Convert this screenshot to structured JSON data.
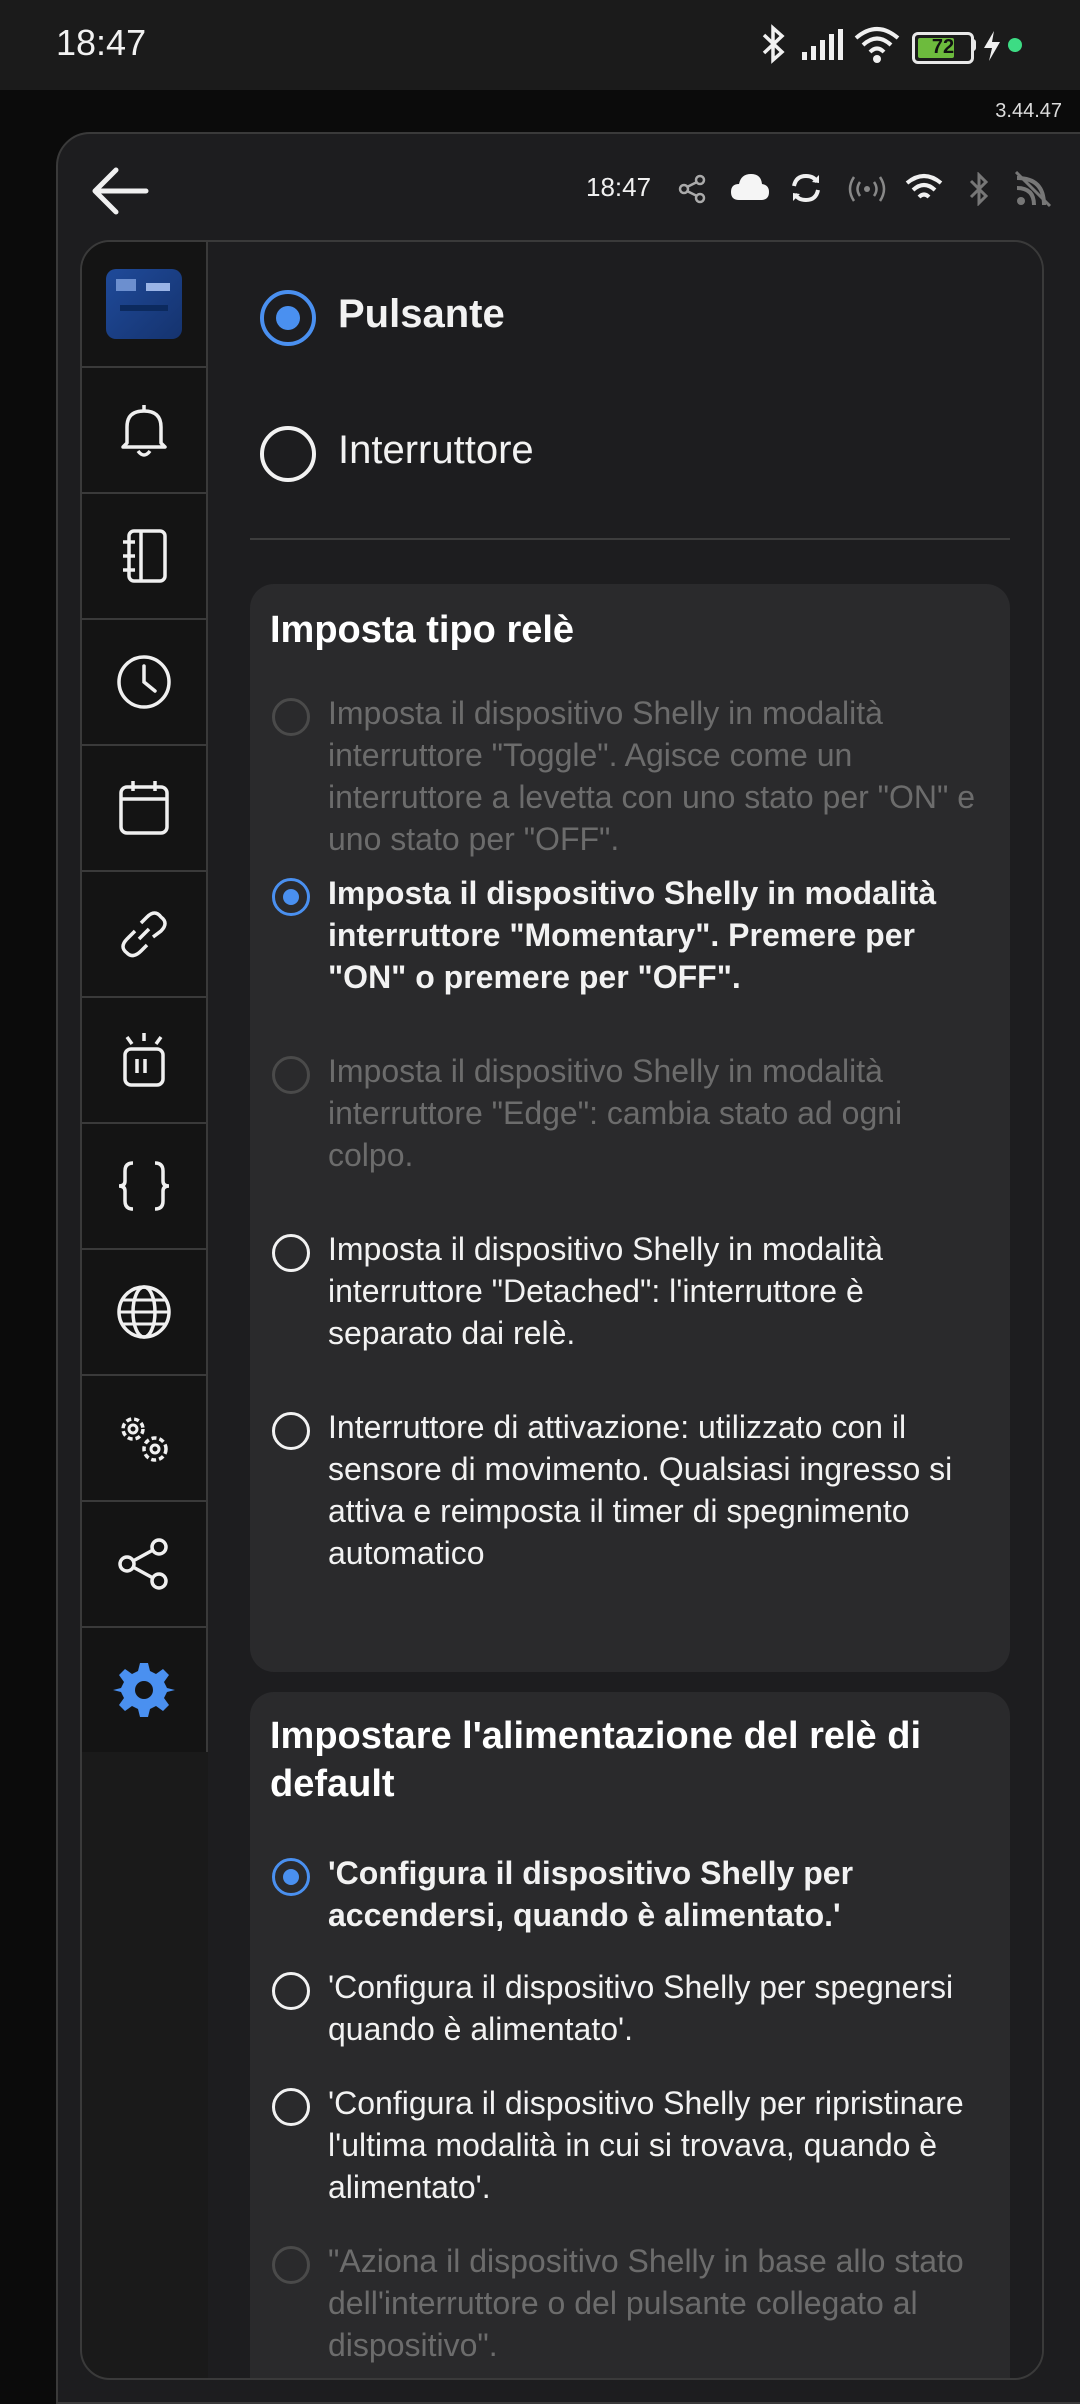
{
  "status_bar": {
    "time": "18:47",
    "battery_level": 72,
    "battery_label": "72",
    "icons": [
      "bluetooth-icon",
      "signal-icon",
      "wifi-icon",
      "battery-icon",
      "charging-icon"
    ]
  },
  "version": "3.44.47",
  "app_bar": {
    "time": "18:47",
    "icons": [
      "share-icon",
      "cloud-icon",
      "sync-icon",
      "broadcast-icon",
      "wifi-icon",
      "bluetooth-icon",
      "rss-icon"
    ]
  },
  "sidebar": {
    "items": [
      {
        "name": "device-thumbnail",
        "icon": "device-image"
      },
      {
        "name": "notifications",
        "icon": "bell-icon"
      },
      {
        "name": "log",
        "icon": "notebook-icon"
      },
      {
        "name": "timers",
        "icon": "clock-icon"
      },
      {
        "name": "schedules",
        "icon": "calendar-icon"
      },
      {
        "name": "actions",
        "icon": "link-icon"
      },
      {
        "name": "webhooks",
        "icon": "alert-icon"
      },
      {
        "name": "scripts",
        "icon": "braces-icon"
      },
      {
        "name": "network",
        "icon": "globe-icon"
      },
      {
        "name": "advanced",
        "icon": "gears-icon"
      },
      {
        "name": "share",
        "icon": "share-icon"
      },
      {
        "name": "settings",
        "icon": "gear-icon",
        "active": true
      }
    ],
    "active_color": "#4a90f0"
  },
  "input_type": {
    "options": [
      {
        "label": "Pulsante",
        "selected": true
      },
      {
        "label": "Interruttore",
        "selected": false
      }
    ]
  },
  "relay_type": {
    "title": "Imposta tipo relè",
    "options": [
      {
        "text": "Imposta il dispositivo Shelly in modalità interruttore \"Toggle\". Agisce come un interruttore a levetta con uno stato per \"ON\" e uno stato per \"OFF\".",
        "state": "disabled"
      },
      {
        "text": "Imposta il dispositivo Shelly in modalità interruttore \"Momentary\". Premere per \"ON\" o premere per \"OFF\".",
        "state": "selected"
      },
      {
        "text": "Imposta il dispositivo Shelly in modalità interruttore \"Edge\": cambia stato ad ogni colpo.",
        "state": "disabled"
      },
      {
        "text": "Imposta il dispositivo Shelly in modalità interruttore \"Detached\": l'interruttore è separato dai relè.",
        "state": "normal"
      },
      {
        "text": "Interruttore di attivazione: utilizzato con il sensore di movimento. Qualsiasi ingresso si attiva e reimposta il timer di spegnimento automatico",
        "state": "normal"
      }
    ]
  },
  "power_default": {
    "title": "Impostare l'alimentazione del relè di default",
    "options": [
      {
        "text": "'Configura il dispositivo Shelly per accendersi, quando è alimentato.'",
        "state": "selected"
      },
      {
        "text": "'Configura il dispositivo Shelly per spegnersi quando è alimentato'.",
        "state": "normal"
      },
      {
        "text": "'Configura il dispositivo Shelly per ripristinare l'ultima modalità in cui si trovava, quando è alimentato'.",
        "state": "normal"
      },
      {
        "text": "\"Aziona il dispositivo Shelly in base allo stato dell'interruttore o del pulsante collegato al dispositivo\".",
        "state": "disabled"
      }
    ]
  }
}
